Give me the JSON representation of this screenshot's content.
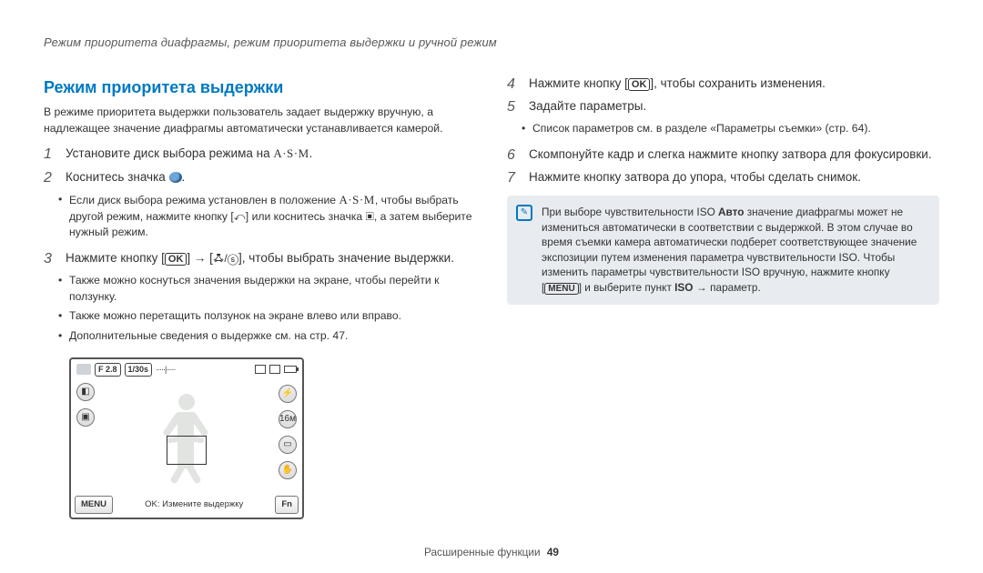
{
  "breadcrumb": "Режим приоритета диафрагмы, режим приоритета выдержки и ручной режим",
  "section_title": "Режим приоритета выдержки",
  "intro": "В режиме приоритета выдержки пользователь задает выдержку вручную, а надлежащее значение диафрагмы автоматически устанавливается камерой.",
  "left": {
    "steps": {
      "s1_num": "1",
      "s1_text_a": "Установите диск выбора режима на ",
      "s1_asm": "A·S·M",
      "s1_text_b": ".",
      "s2_num": "2",
      "s2_text_a": "Коснитесь значка ",
      "s2_text_b": ".",
      "s2_sub1_a": "Если диск выбора режима установлен в положение ",
      "s2_sub1_asm": "A·S·M",
      "s2_sub1_b": ", чтобы выбрать другой режим, нажмите кнопку [",
      "s2_sub1_c": "] или коснитесь значка ",
      "s2_sub1_d": ", а затем выберите нужный режим.",
      "return_icon": "⤺",
      "mode_icon": "▣",
      "s3_num": "3",
      "s3_text_a": "Нажмите кнопку [",
      "s3_ok": "OK",
      "s3_text_b": "] → [",
      "s3_flash": "ꗈ/ⓢ",
      "s3_text_c": "], чтобы выбрать значение выдержки.",
      "s3_sub1": "Также можно коснуться значения выдержки на экране, чтобы перейти к ползунку.",
      "s3_sub2": "Также можно перетащить ползунок на экране влево или вправо.",
      "s3_sub3": "Дополнительные сведения о выдержке см. на стр. 47."
    }
  },
  "right": {
    "s4_num": "4",
    "s4_a": "Нажмите кнопку [",
    "s4_ok": "OK",
    "s4_b": "], чтобы сохранить изменения.",
    "s5_num": "5",
    "s5_text": "Задайте параметры.",
    "s5_sub1": "Список параметров см. в разделе «Параметры съемки» (стр. 64).",
    "s6_num": "6",
    "s6_text": "Скомпонуйте кадр и слегка нажмите кнопку затвора для фокусировки.",
    "s7_num": "7",
    "s7_text": "Нажмите кнопку затвора до упора, чтобы сделать снимок."
  },
  "note": {
    "a": "При выборе чувствительности ISO ",
    "auto": "Авто",
    "b": " значение диафрагмы может не измениться автоматически в соответствии с выдержкой. В этом случае во время съемки камера автоматически подберет соответствующее значение экспозиции путем изменения параметра чувствительности ISO. Чтобы изменить параметры чувствительности ISO вручную, нажмите кнопку [",
    "menu": "MENU",
    "c": "] и выберите пункт ",
    "iso": "ISO",
    "arrow": " → ",
    "d": "параметр."
  },
  "preview": {
    "f": "F 2.8",
    "shutter": "1/30s",
    "meter": "·····|·····",
    "menu_btn": "MENU",
    "center": "OK: Измените выдержку",
    "fn_btn": "Fn"
  },
  "footer": {
    "label": "Расширенные функции",
    "page": "49"
  }
}
